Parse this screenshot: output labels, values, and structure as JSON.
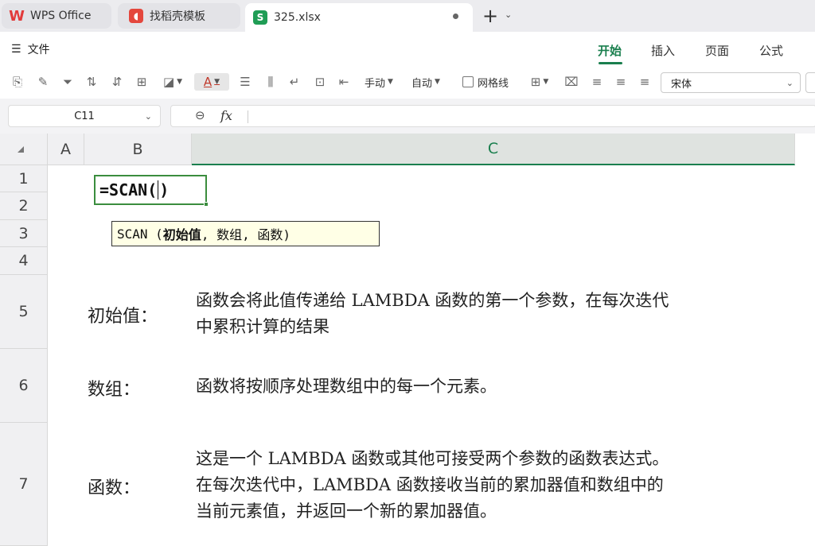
{
  "tabs": {
    "wps": "WPS Office",
    "template": "找稻壳模板",
    "file": "325.xlsx"
  },
  "ribbon": {
    "file_menu": "文件",
    "tabs": [
      "开始",
      "插入",
      "页面",
      "公式"
    ]
  },
  "toolbar": {
    "manual": "手动",
    "auto": "自动",
    "gridlines": "网格线",
    "font": "宋体"
  },
  "formula_bar": {
    "name_box": "C11",
    "fx": "fx"
  },
  "sheet": {
    "columns": [
      "A",
      "B",
      "C"
    ],
    "rows": [
      "1",
      "2",
      "3",
      "4",
      "5",
      "6",
      "7"
    ],
    "active_cell_text_before": "=SCAN(",
    "active_cell_text_after": ")",
    "tooltip": {
      "prefix": "SCAN (",
      "arg1": "初始值",
      "rest": ", 数组, 函数)"
    },
    "params": [
      {
        "label": "初始值：",
        "lines": [
          "函数会将此值传递给 LAMBDA 函数的第一个参数，在每次迭代",
          "中累积计算的结果"
        ]
      },
      {
        "label": "数组：",
        "lines": [
          "函数将按顺序处理数组中的每一个元素。"
        ]
      },
      {
        "label": "函数：",
        "lines": [
          "这是一个 LAMBDA 函数或其他可接受两个参数的函数表达式。",
          "在每次迭代中，LAMBDA 函数接收当前的累加器值和数组中的",
          "当前元素值，并返回一个新的累加器值。"
        ]
      }
    ]
  },
  "colors": {
    "accent_green": "#1a7f4e",
    "cell_border": "#3b8d3e",
    "tooltip_bg": "#ffffe6"
  }
}
